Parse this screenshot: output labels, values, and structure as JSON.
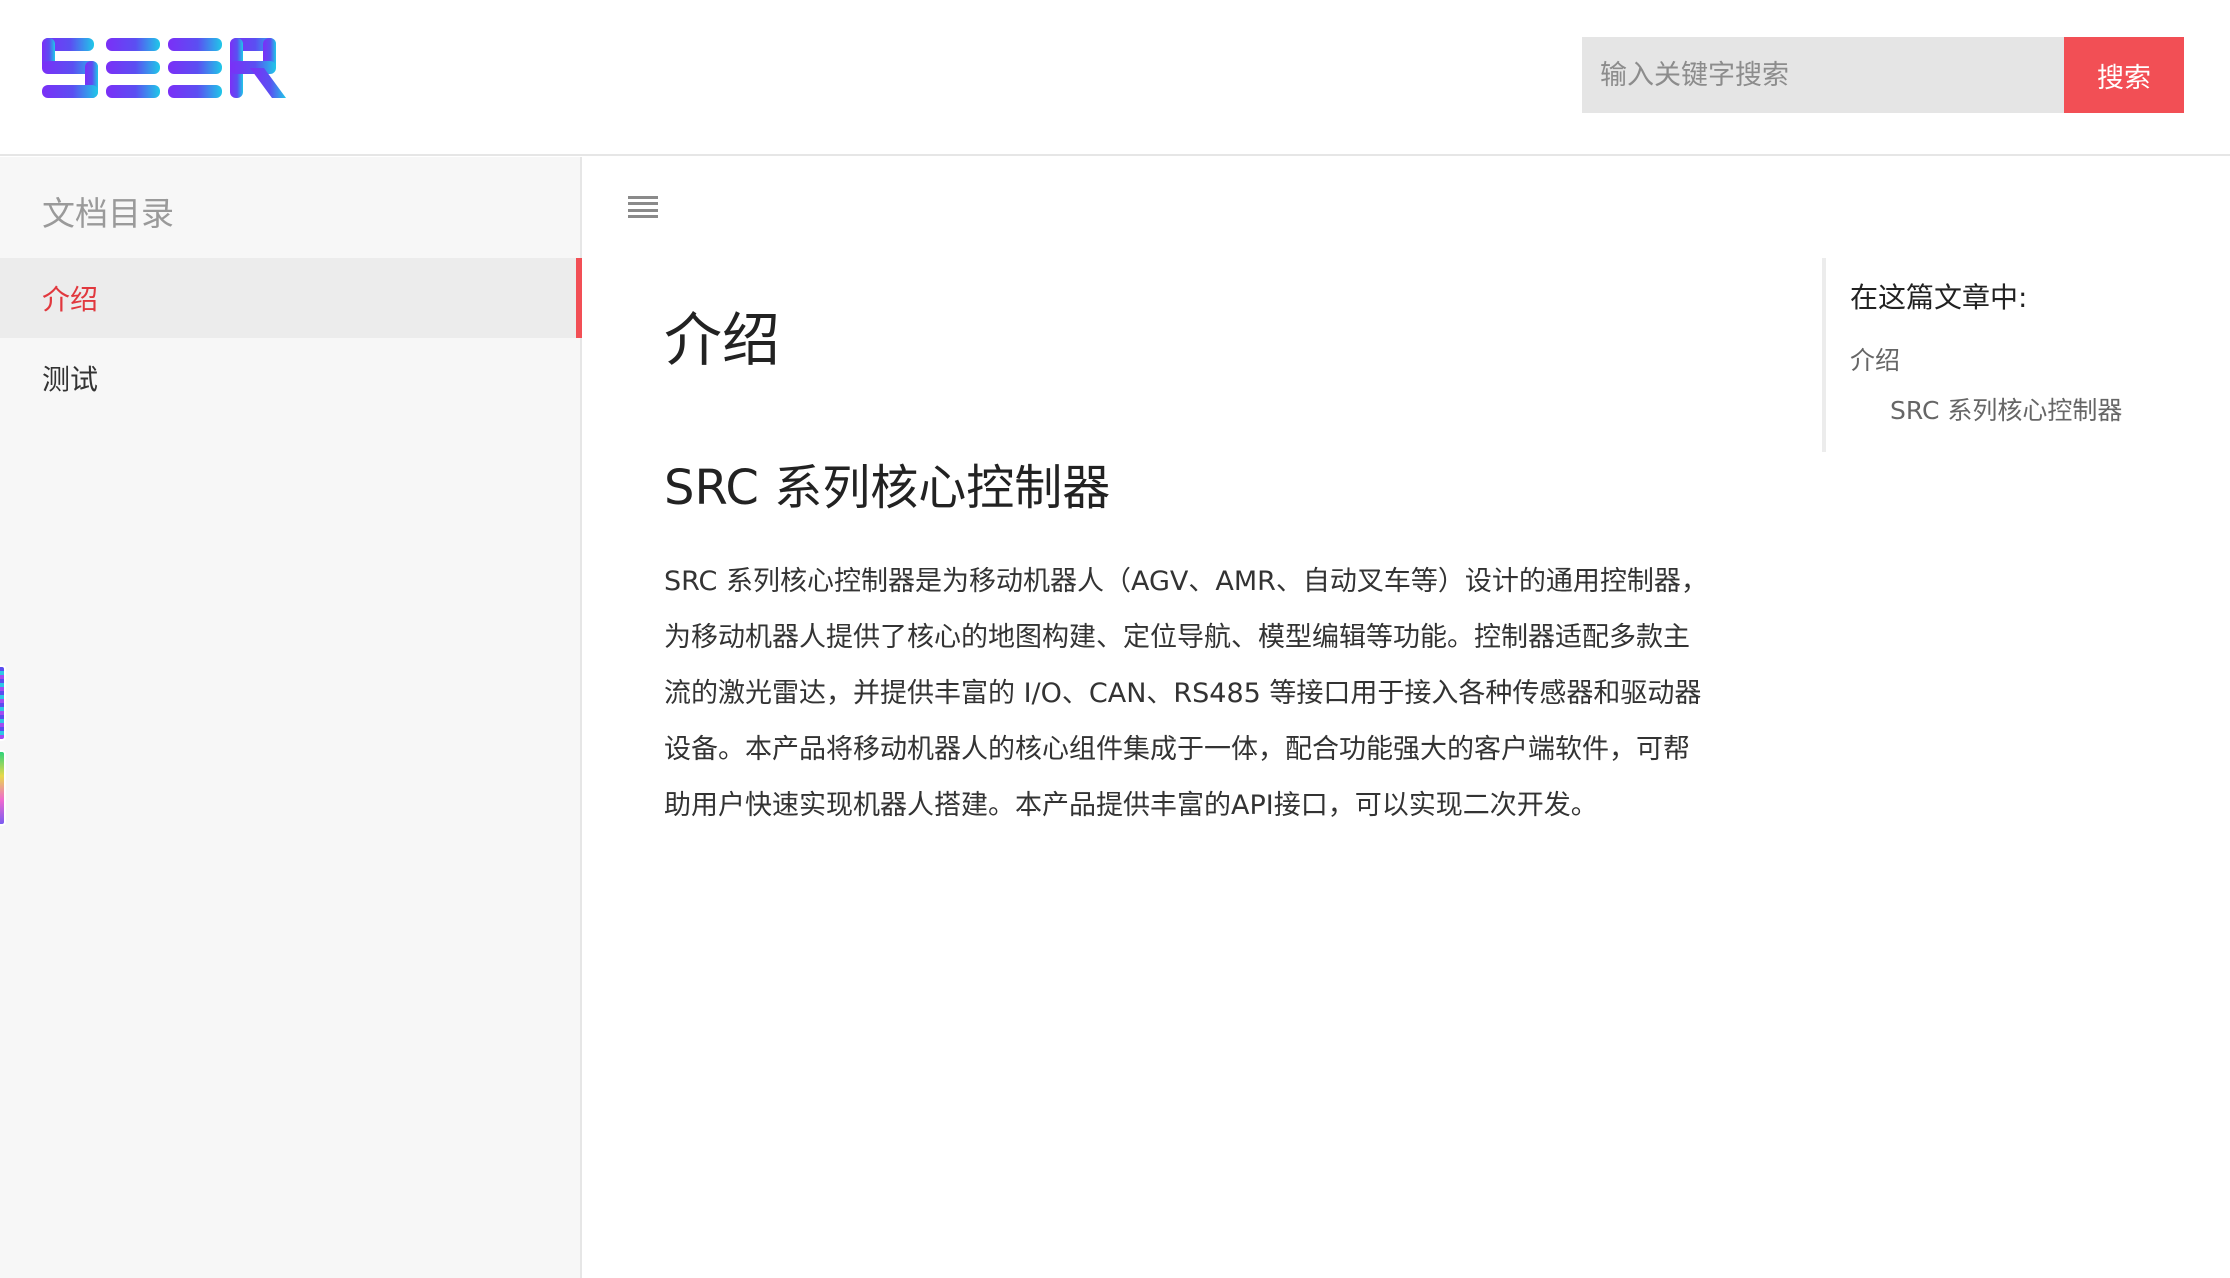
{
  "header": {
    "logo_text": "SEER",
    "search": {
      "placeholder": "输入关键字搜索",
      "button_label": "搜索"
    }
  },
  "sidebar": {
    "title": "文档目录",
    "items": [
      {
        "label": "介绍",
        "active": true
      },
      {
        "label": "测试",
        "active": false
      }
    ]
  },
  "toolbar": {
    "toc_toggle_icon": "hamburger-menu-icon"
  },
  "article": {
    "title": "介绍",
    "section_heading": "SRC 系列核心控制器",
    "paragraph": "SRC 系列核心控制器是为移动机器人（AGV、AMR、自动叉车等）设计的通用控制器，为移动机器人提供了核心的地图构建、定位导航、模型编辑等功能。控制器适配多款主流的激光雷达，并提供丰富的 I/O、CAN、RS485 等接口用于接入各种传感器和驱动器设备。本产品将移动机器人的核心组件集成于一体，配合功能强大的客户端软件，可帮助用户快速实现机器人搭建。本产品提供丰富的API接口，可以实现二次开发。"
  },
  "toc": {
    "heading": "在这篇文章中:",
    "links": [
      {
        "label": "介绍"
      },
      {
        "label": "SRC 系列核心控制器"
      }
    ]
  },
  "colors": {
    "accent": "#f24f55",
    "active_text": "#e1383e",
    "logo_gradient_start": "#7b2ff7",
    "logo_gradient_end": "#1fc8e8"
  }
}
